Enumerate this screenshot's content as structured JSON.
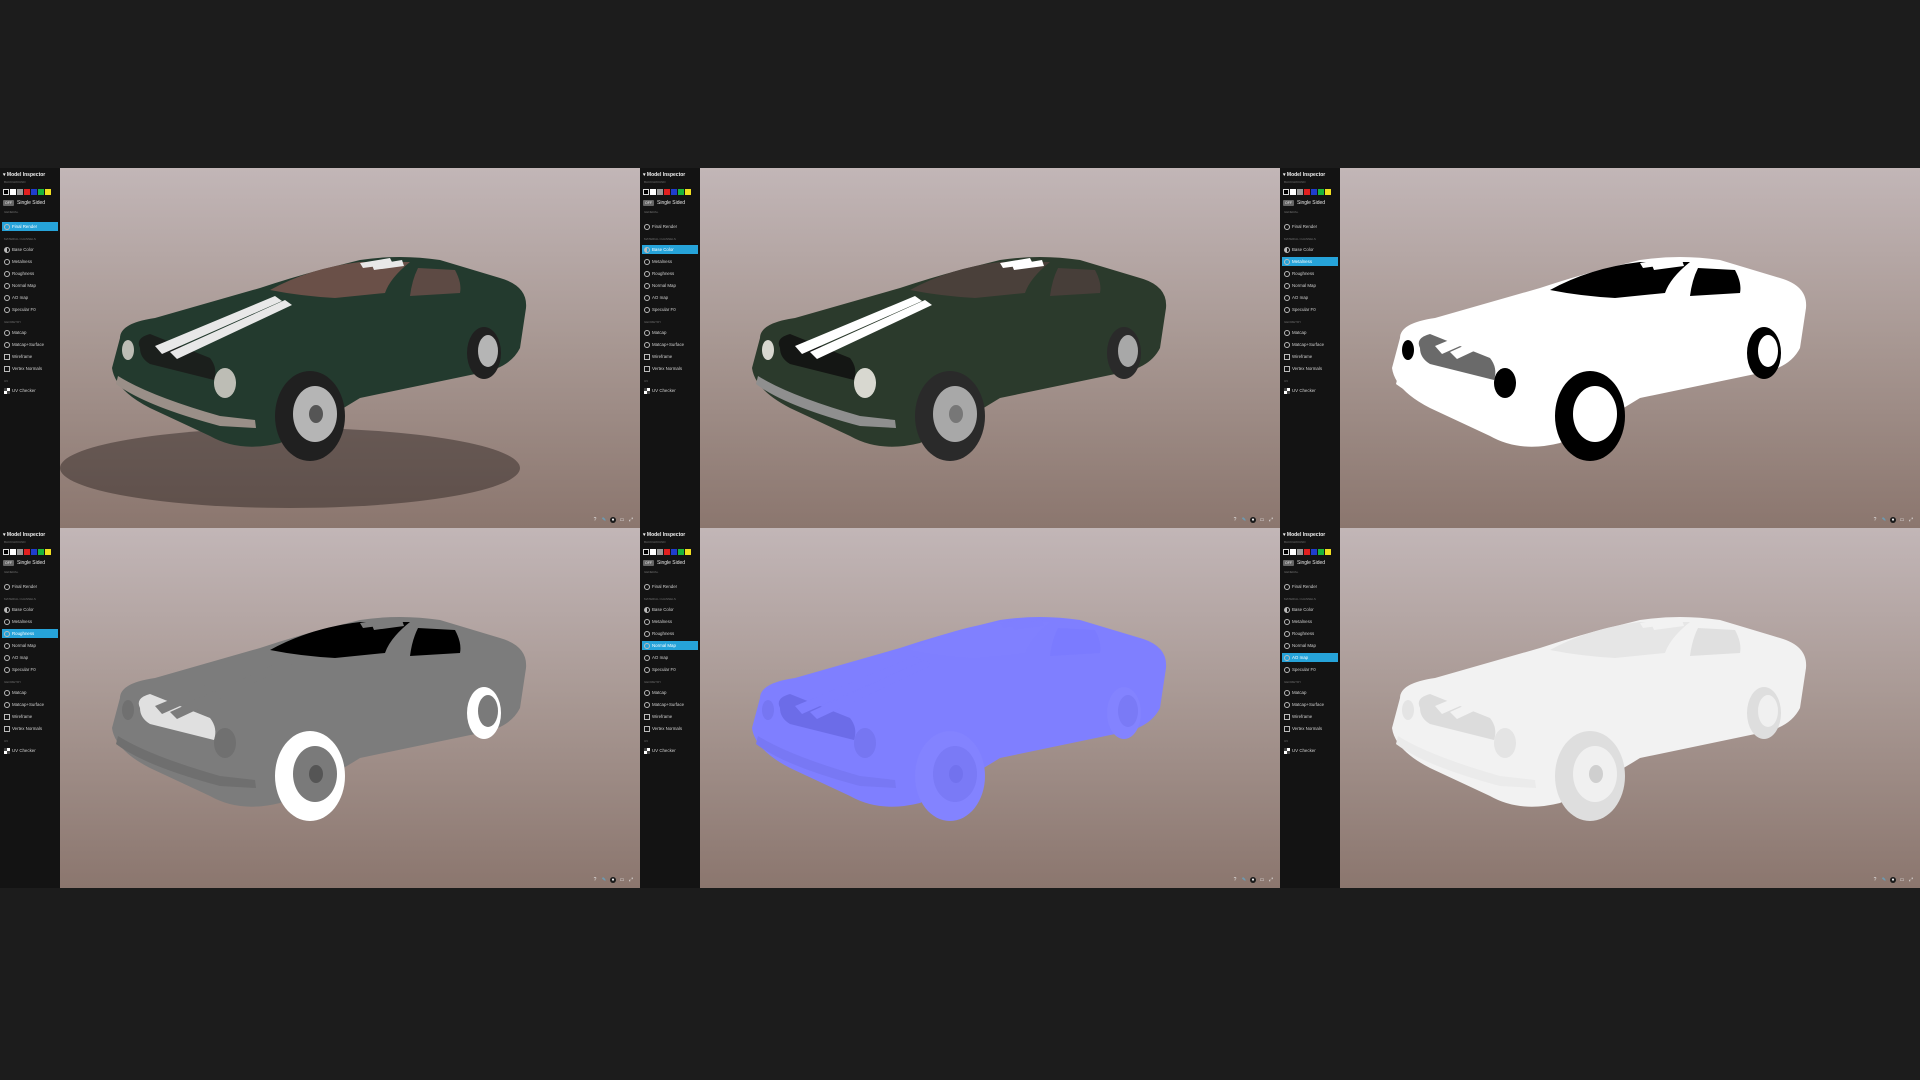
{
  "inspector": {
    "title": "Model Inspector",
    "sections": {
      "background": "BACKGROUND",
      "general": "GENERAL",
      "material": "MATERIAL CHANNELS",
      "geometry": "GEOMETRY",
      "uv": "UV"
    },
    "background_swatches": [
      "#000000",
      "#ffffff",
      "#9a9a9a",
      "#e02020",
      "#1f3dcc",
      "#1ab43c",
      "#f0e020"
    ],
    "single_sided": {
      "badge": "OFF",
      "label": "Single Sided"
    },
    "items": {
      "final_render": "Final Render",
      "base_color": "Base Color",
      "metalness": "Metalness",
      "roughness": "Roughness",
      "normal_map": "Normal Map",
      "ao_map": "AO map",
      "specular_f0": "Specular F0",
      "matcap": "Matcap",
      "matcap_surface": "Matcap+Surface",
      "wireframe": "Wireframe",
      "vertex_normals": "Vertex Normals",
      "uv_checker": "UV Checker"
    },
    "toolbar_icons": [
      "help-icon",
      "pencil-icon",
      "record-icon",
      "vr-icon",
      "fullscreen-icon"
    ]
  },
  "panels": [
    {
      "mode": "final_render",
      "active_item": "Final Render",
      "car_style": "render"
    },
    {
      "mode": "base_color",
      "active_item": "Base Color",
      "car_style": "basecolor"
    },
    {
      "mode": "metalness",
      "active_item": "Metalness",
      "car_style": "metalness"
    },
    {
      "mode": "roughness",
      "active_item": "Roughness",
      "car_style": "roughness"
    },
    {
      "mode": "normal_map",
      "active_item": "Normal Map",
      "car_style": "normal"
    },
    {
      "mode": "ao_map",
      "active_item": "AO map",
      "car_style": "ao"
    }
  ],
  "colors": {
    "accent": "#26a3d9",
    "page_bg": "#1c1c1c",
    "sidebar_bg": "#131313"
  }
}
